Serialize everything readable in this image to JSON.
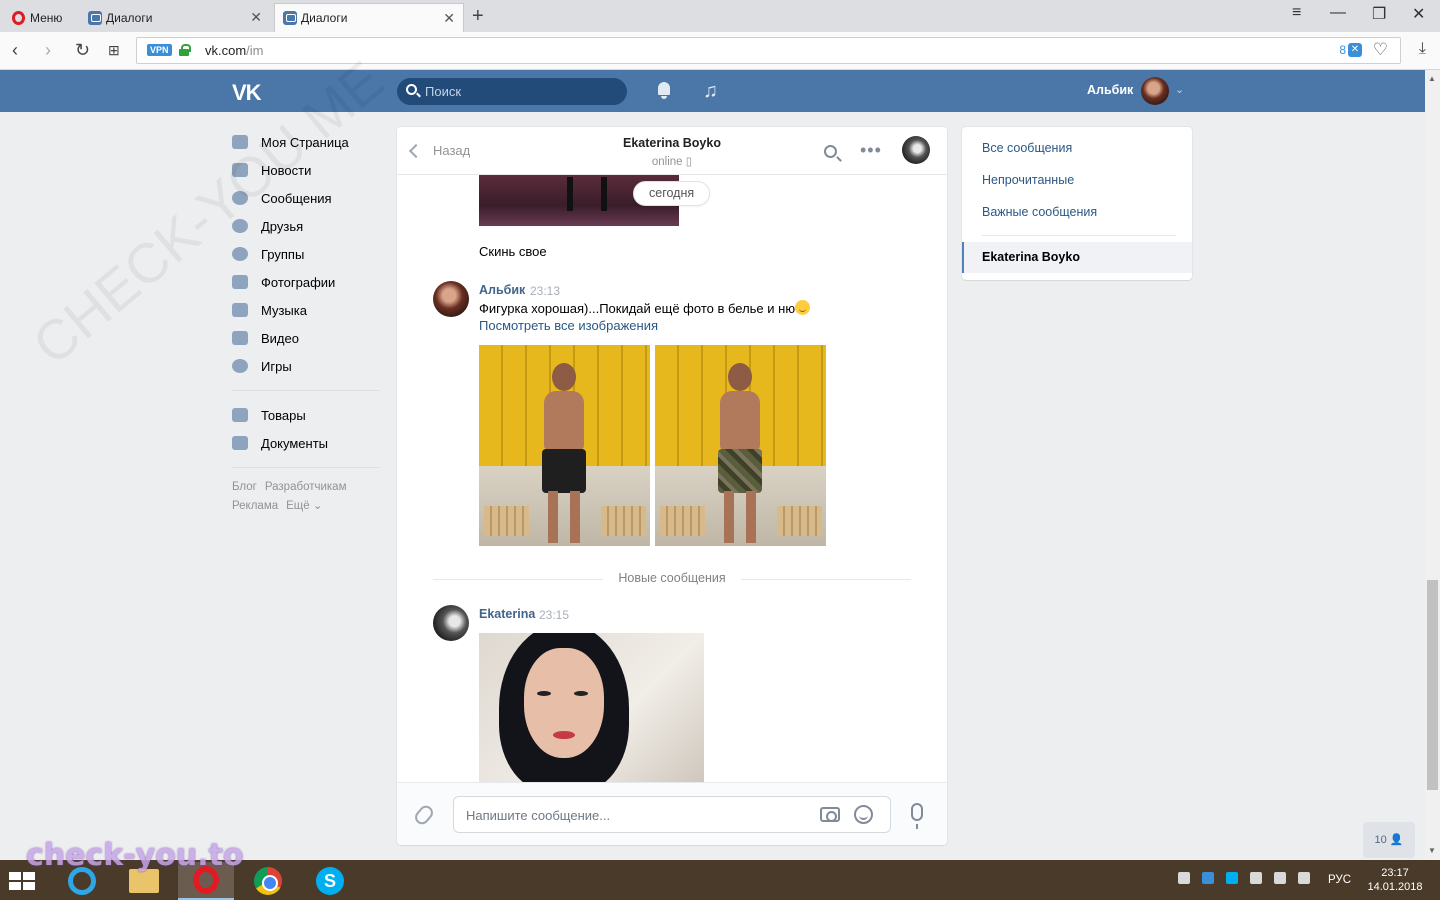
{
  "browser": {
    "menu_label": "Меню",
    "tabs": [
      {
        "label": "Диалоги"
      },
      {
        "label": "Диалоги"
      }
    ],
    "vpn_label": "VPN",
    "url_host": "vk.com",
    "url_path": "/im",
    "adblock_count": "8"
  },
  "vk_header": {
    "logo": "VK",
    "search_placeholder": "Поиск",
    "username": "Альбик"
  },
  "left_menu": {
    "items": [
      {
        "label": "Моя Страница"
      },
      {
        "label": "Новости"
      },
      {
        "label": "Сообщения"
      },
      {
        "label": "Друзья"
      },
      {
        "label": "Группы"
      },
      {
        "label": "Фотографии"
      },
      {
        "label": "Музыка"
      },
      {
        "label": "Видео"
      },
      {
        "label": "Игры"
      }
    ],
    "items2": [
      {
        "label": "Товары"
      },
      {
        "label": "Документы"
      }
    ],
    "footer": [
      "Блог",
      "Разработчикам",
      "Реклама",
      "Ещё ⌄"
    ]
  },
  "chat": {
    "back_label": "Назад",
    "peer_name": "Ekaterina Boyko",
    "peer_status": "online",
    "date_chip": "сегодня",
    "msg1_text": "Скинь свое",
    "msg2": {
      "author": "Альбик",
      "time": "23:13",
      "text": "Фигурка хорошая)...Покидай ещё фото в белье и ню",
      "link": "Посмотреть все изображения"
    },
    "new_messages_label": "Новые сообщения",
    "msg3": {
      "author": "Ekaterina",
      "time": "23:15"
    },
    "composer_placeholder": "Напишите сообщение..."
  },
  "right_panel": {
    "items": [
      {
        "label": "Все сообщения"
      },
      {
        "label": "Непрочитанные"
      },
      {
        "label": "Важные сообщения"
      }
    ],
    "active": "Ekaterina Boyko"
  },
  "online_badge": "10",
  "taskbar": {
    "lang": "РУС",
    "time": "23:17",
    "date": "14.01.2018"
  },
  "watermark": "check-you.to",
  "watermark_diag": "CHECK-YOU.ME"
}
